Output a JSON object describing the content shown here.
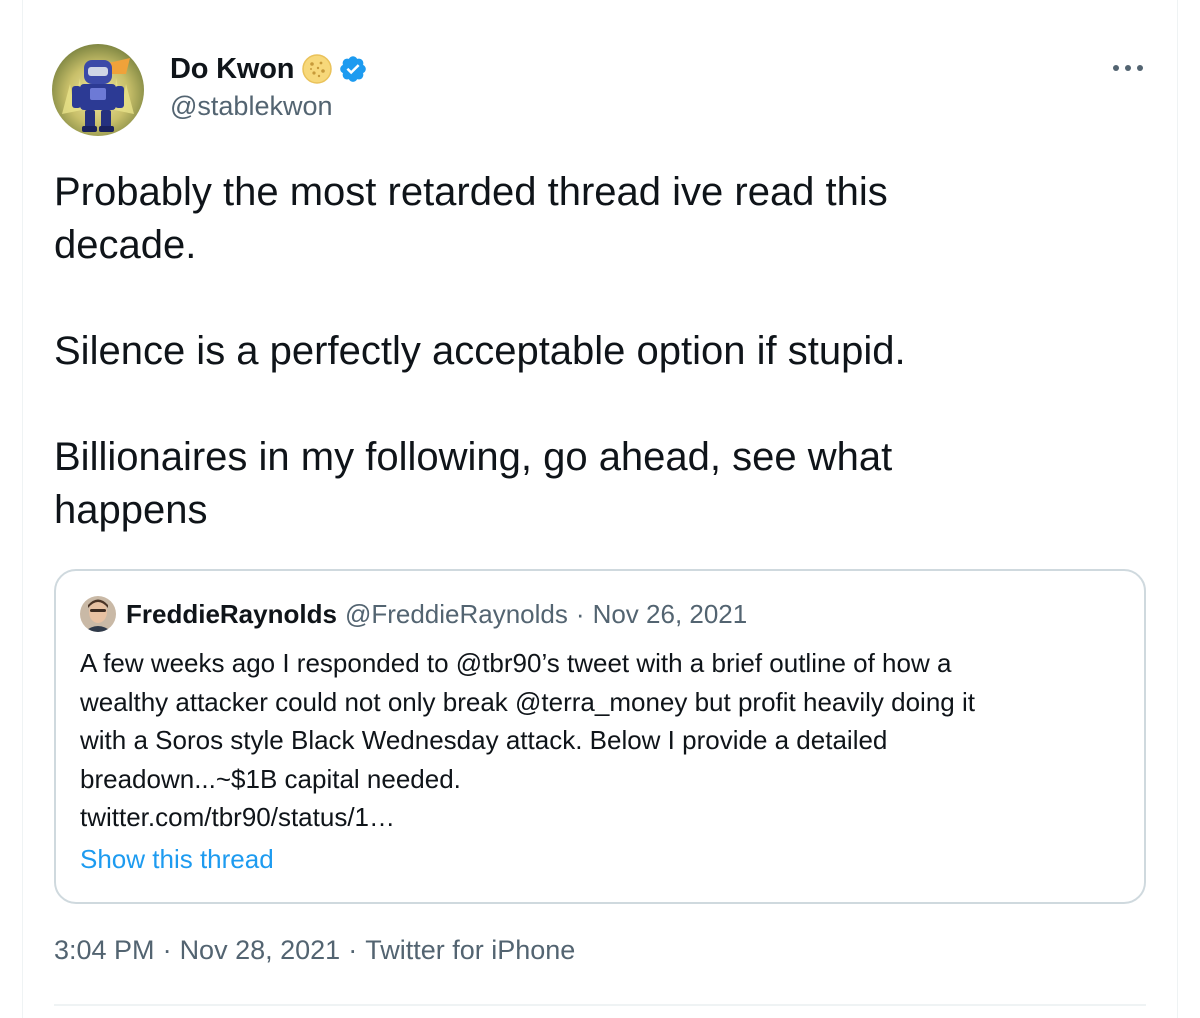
{
  "tweet": {
    "author": {
      "display_name": "Do Kwon",
      "handle": "@stablekwon",
      "name_emoji": "cookie-icon",
      "verified": true
    },
    "text_paragraphs": [
      [
        "Probably the most retarded thread ive read this",
        "decade."
      ],
      [
        "Silence is a perfectly acceptable option if stupid."
      ],
      [
        "Billionaires in my following, go ahead, see what",
        "happens"
      ]
    ],
    "quoted": {
      "display_name": "FreddieRaynolds",
      "handle": "@FreddieRaynolds",
      "separator": "·",
      "date": "Nov 26, 2021",
      "text_lines": [
        "A few weeks ago I responded to @tbr90’s tweet with a brief outline of how a",
        "wealthy attacker could not only break @terra_money but profit heavily doing it",
        "with a Soros style Black Wednesday attack. Below I provide a detailed",
        "breadown...~$1B capital needed.",
        "twitter.com/tbr90/status/1…"
      ],
      "show_thread_label": "Show this thread"
    },
    "meta": {
      "time": "3:04 PM",
      "separator": "·",
      "date": "Nov 28, 2021",
      "source": "Twitter for iPhone"
    }
  },
  "colors": {
    "text_primary": "#0f1419",
    "text_secondary": "#536471",
    "link": "#1d9bf0",
    "verified_badge": "#1d9bf0",
    "quote_border": "#cfd9de"
  }
}
